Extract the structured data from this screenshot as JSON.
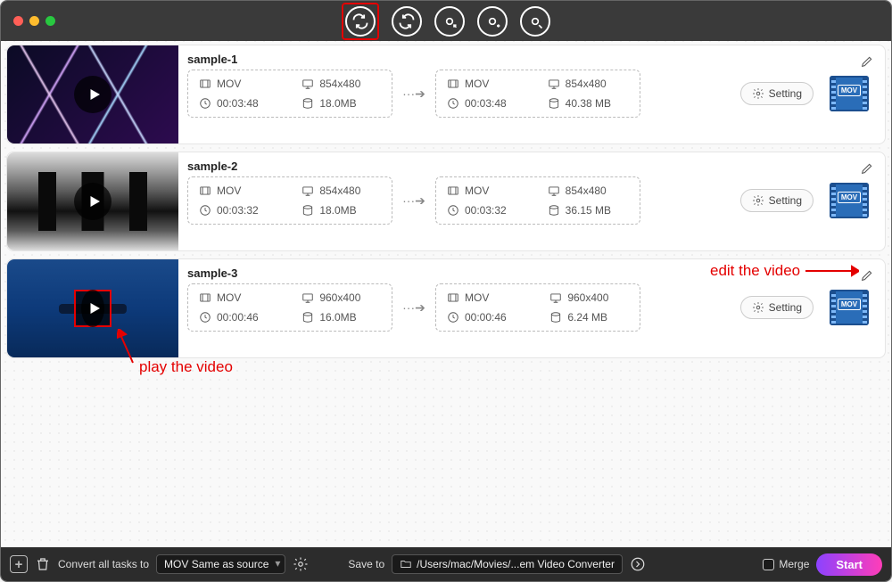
{
  "videos": [
    {
      "name": "sample-1",
      "src": {
        "format": "MOV",
        "res": "854x480",
        "dur": "00:03:48",
        "size": "18.0MB"
      },
      "dst": {
        "format": "MOV",
        "res": "854x480",
        "dur": "00:03:48",
        "size": "40.38 MB"
      },
      "badge": "MOV"
    },
    {
      "name": "sample-2",
      "src": {
        "format": "MOV",
        "res": "854x480",
        "dur": "00:03:32",
        "size": "18.0MB"
      },
      "dst": {
        "format": "MOV",
        "res": "854x480",
        "dur": "00:03:32",
        "size": "36.15 MB"
      },
      "badge": "MOV"
    },
    {
      "name": "sample-3",
      "src": {
        "format": "MOV",
        "res": "960x400",
        "dur": "00:00:46",
        "size": "16.0MB"
      },
      "dst": {
        "format": "MOV",
        "res": "960x400",
        "dur": "00:00:46",
        "size": "6.24 MB"
      },
      "badge": "MOV"
    }
  ],
  "ui": {
    "setting_label": "Setting",
    "convert_all_label": "Convert all tasks to",
    "preset": "MOV Same as source",
    "save_to_label": "Save to",
    "save_path": "/Users/mac/Movies/...em Video Converter",
    "merge_label": "Merge",
    "start_label": "Start"
  },
  "annotations": {
    "play": "play the video",
    "edit": "edit the video"
  }
}
